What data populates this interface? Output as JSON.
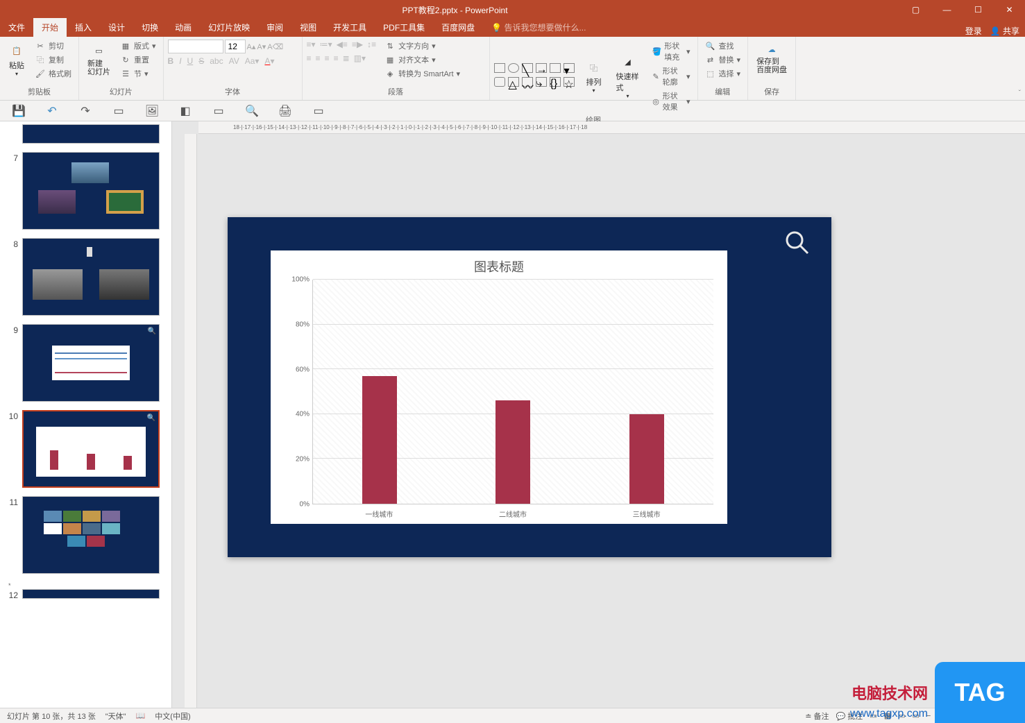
{
  "titlebar": {
    "filename": "PPT教程2.pptx - PowerPoint"
  },
  "tabs": {
    "file": "文件",
    "home": "开始",
    "insert": "插入",
    "design": "设计",
    "transition": "切换",
    "animation": "动画",
    "slideshow": "幻灯片放映",
    "review": "审阅",
    "view": "视图",
    "developer": "开发工具",
    "pdf": "PDF工具集",
    "baidu": "百度网盘",
    "tell": "告诉我您想要做什么...",
    "login": "登录",
    "share": "共享"
  },
  "ribbon": {
    "clipboard": {
      "paste": "粘贴",
      "cut": "剪切",
      "copy": "复制",
      "format_painter": "格式刷",
      "label": "剪贴板"
    },
    "slides": {
      "new_slide": "新建\n幻灯片",
      "layout": "版式",
      "reset": "重置",
      "section": "节",
      "label": "幻灯片"
    },
    "font": {
      "name": "",
      "size": "12",
      "label": "字体"
    },
    "paragraph": {
      "text_direction": "文字方向",
      "align_text": "对齐文本",
      "smartart": "转换为 SmartArt",
      "label": "段落"
    },
    "drawing": {
      "arrange": "排列",
      "quick_style": "快速样式",
      "shape_fill": "形状填充",
      "shape_outline": "形状轮廓",
      "shape_effects": "形状效果",
      "label": "绘图"
    },
    "editing": {
      "find": "查找",
      "replace": "替换",
      "select": "选择",
      "label": "编辑"
    },
    "save": {
      "save_to": "保存到\n百度网盘",
      "label": "保存"
    }
  },
  "slide_numbers": [
    "7",
    "8",
    "9",
    "10",
    "11",
    "12"
  ],
  "chart_data": {
    "type": "bar",
    "title": "图表标题",
    "categories": [
      "一线城市",
      "二线城市",
      "三线城市"
    ],
    "values": [
      57,
      46,
      40
    ],
    "ylabel": "",
    "xlabel": "",
    "ylim": [
      0,
      100
    ],
    "yticks": [
      "0%",
      "20%",
      "40%",
      "60%",
      "80%",
      "100%"
    ]
  },
  "statusbar": {
    "slide_info": "幻灯片 第 10 张，共 13 张",
    "theme": "\"天体\"",
    "language": "中文(中国)",
    "notes": "备注",
    "comments": "批注"
  },
  "watermark": {
    "main": "电脑技术网",
    "url": "www.tagxp.com",
    "tag": "TAG"
  }
}
